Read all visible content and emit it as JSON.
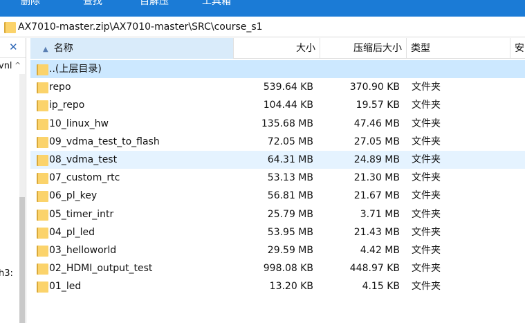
{
  "toolbar": {
    "items": [
      "删除",
      "查找",
      "自解压",
      "工具箱"
    ]
  },
  "address": {
    "path": "AX7010-master.zip\\AX7010-master\\SRC\\course_s1"
  },
  "left_pane": {
    "close_symbol": "✕",
    "row_a": "vnl",
    "scroll_up_symbol": "^",
    "row_b": "h3:"
  },
  "columns": {
    "name": "名称",
    "size": "大小",
    "compressed_size": "压缩后大小",
    "type": "类型",
    "more": "安"
  },
  "sort_indicator": "▲",
  "parent_dir": "..(上层目录)",
  "rows": [
    {
      "name": "repo",
      "size": "539.64 KB",
      "csize": "370.90 KB",
      "type": "文件夹"
    },
    {
      "name": "ip_repo",
      "size": "104.44 KB",
      "csize": "19.57 KB",
      "type": "文件夹"
    },
    {
      "name": "10_linux_hw",
      "size": "135.68 MB",
      "csize": "47.46 MB",
      "type": "文件夹"
    },
    {
      "name": "09_vdma_test_to_flash",
      "size": "72.05 MB",
      "csize": "27.05 MB",
      "type": "文件夹"
    },
    {
      "name": "08_vdma_test",
      "size": "64.31 MB",
      "csize": "24.89 MB",
      "type": "文件夹"
    },
    {
      "name": "07_custom_rtc",
      "size": "53.13 MB",
      "csize": "21.30 MB",
      "type": "文件夹"
    },
    {
      "name": "06_pl_key",
      "size": "56.81 MB",
      "csize": "21.67 MB",
      "type": "文件夹"
    },
    {
      "name": "05_timer_intr",
      "size": "25.79 MB",
      "csize": "3.71 MB",
      "type": "文件夹"
    },
    {
      "name": "04_pl_led",
      "size": "53.95 MB",
      "csize": "21.43 MB",
      "type": "文件夹"
    },
    {
      "name": "03_helloworld",
      "size": "29.59 MB",
      "csize": "4.42 MB",
      "type": "文件夹"
    },
    {
      "name": "02_HDMI_output_test",
      "size": "998.08 KB",
      "csize": "448.97 KB",
      "type": "文件夹"
    },
    {
      "name": "01_led",
      "size": "13.20 KB",
      "csize": "4.15 KB",
      "type": "文件夹"
    }
  ],
  "colors": {
    "toolbar": "#1b7bd6",
    "selected_row": "#cce8ff",
    "hover_row": "#e5f3ff",
    "folder": "#fbd36b"
  }
}
